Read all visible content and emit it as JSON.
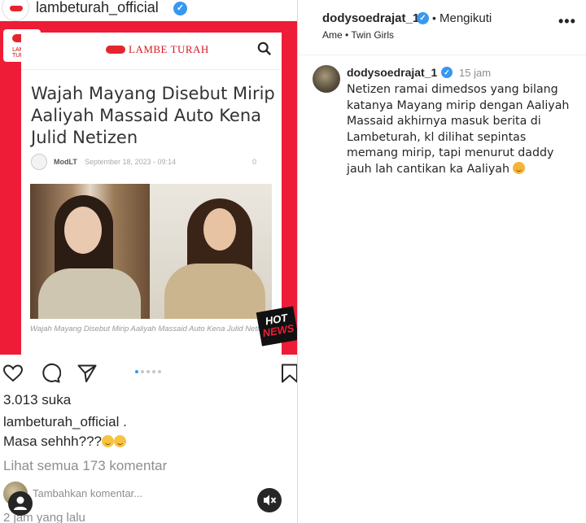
{
  "post": {
    "username": "lambeturah_official",
    "image": {
      "side_logo_text": "LAMBE TURAH",
      "brand": "LAMBE TURAH",
      "article_title": "Wajah Mayang Disebut Mirip Aaliyah Massaid Auto Kena Julid Netizen",
      "author": "ModLT",
      "date": "September 18, 2023 - 09:14",
      "comment_count": "0",
      "photo_caption": "Wajah Mayang Disebut Mirip Aaliyah Massaid Auto Kena Julid Netizen",
      "badge_line1": "HOT",
      "badge_line2": "NEWS"
    },
    "likes": "3.013 suka",
    "caption_user": "lambeturah_official .",
    "caption_text": "Masa sehhh???",
    "view_comments": "Lihat semua 173 komentar",
    "add_comment_placeholder": "Tambahkan komentar...",
    "time_ago": "2 jam yang lalu"
  },
  "panel": {
    "username": "dodysoedrajat_1",
    "separator": "•",
    "follow_status": "Mengikuti",
    "audio": "Ame • Twin Girls",
    "more": "•••",
    "comment": {
      "username": "dodysoedrajat_1",
      "time": "15 jam",
      "body": "Netizen ramai dimedsos yang bilang katanya Mayang mirip dengan Aaliyah Massaid akhirnya masuk berita di Lambeturah, kl dilihat sepintas memang mirip, tapi menurut daddy jauh lah cantikan ka Aaliyah"
    }
  },
  "colors": {
    "verified": "#3897f0",
    "brand_red": "#ee1c37",
    "muted_text": "#8e8e8e"
  },
  "carousel": {
    "count": 5,
    "active_index": 0
  }
}
